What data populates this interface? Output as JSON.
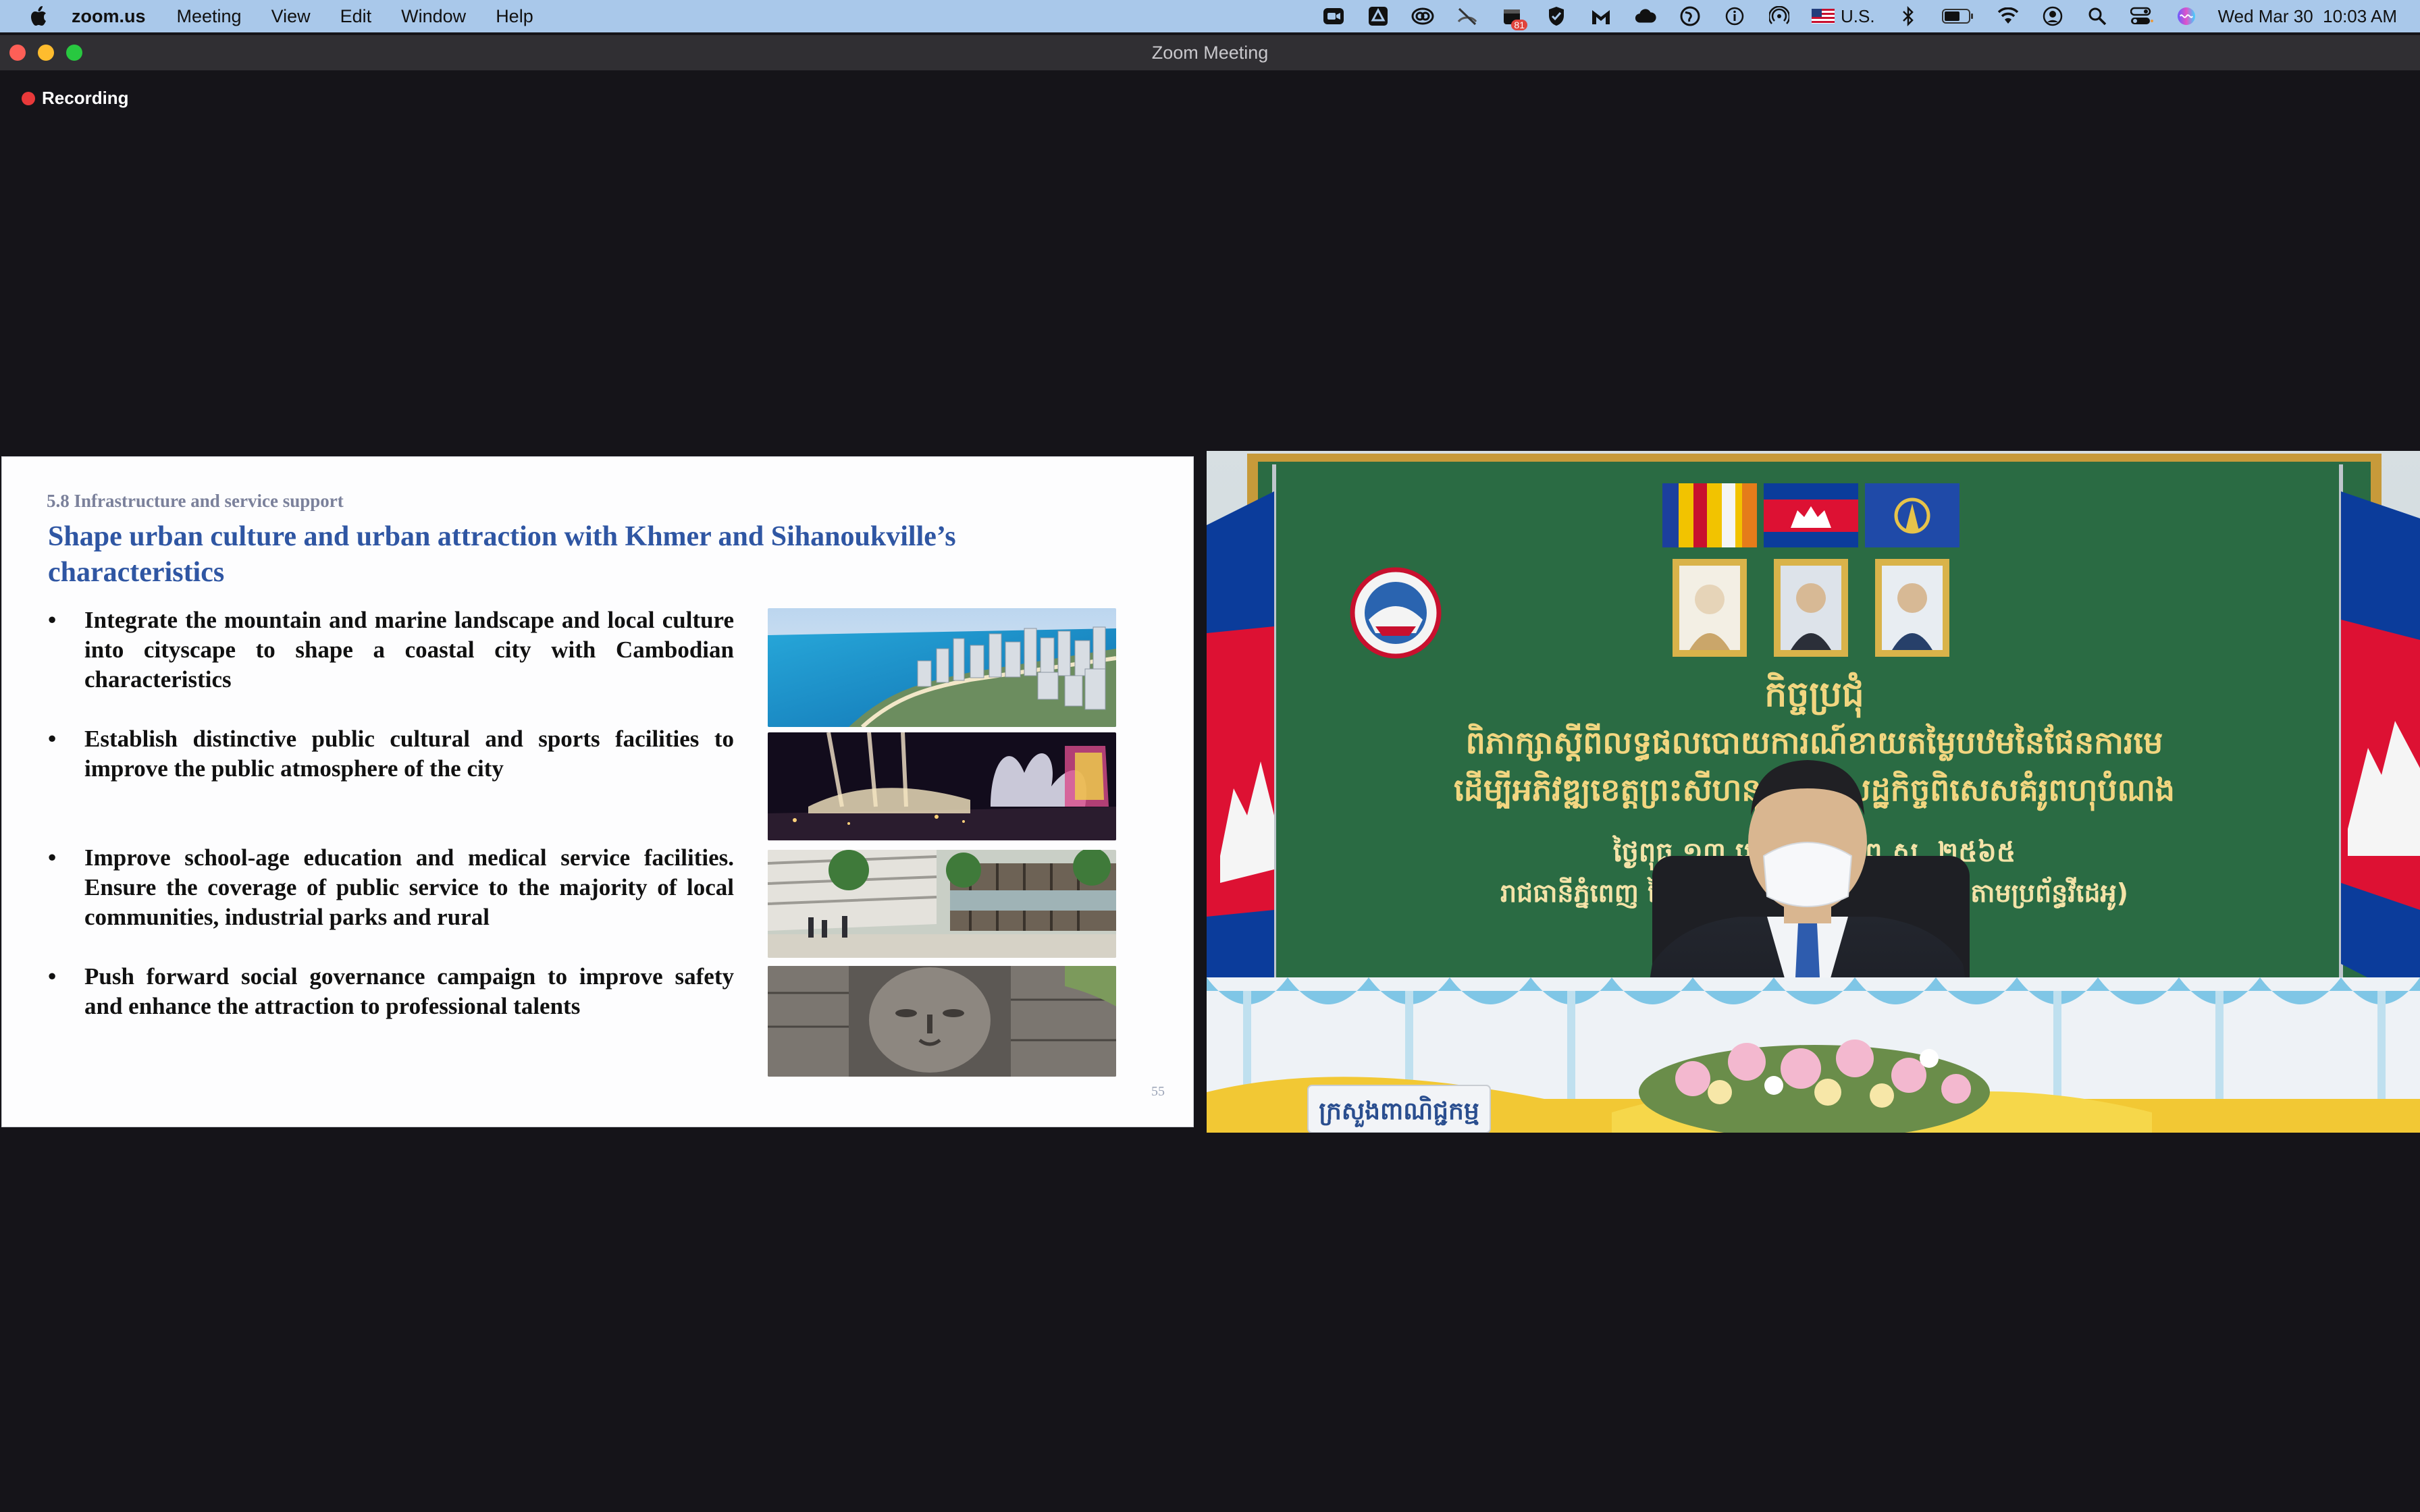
{
  "menubar": {
    "app_name": "zoom.us",
    "items": [
      "Meeting",
      "View",
      "Edit",
      "Window",
      "Help"
    ],
    "tray": {
      "notification_badge": "81",
      "input_source": "U.S.",
      "datetime": "Wed Mar 30  10:03 AM"
    }
  },
  "window": {
    "title": "Zoom Meeting"
  },
  "recording": {
    "label": "Recording"
  },
  "slide": {
    "subtitle": "5.8 Infrastructure and service support",
    "title": "Shape urban culture and urban attraction with Khmer and Sihanoukville’s characteristics",
    "bullets": [
      "Integrate the mountain and marine landscape and local culture into cityscape to shape a coastal city with Cambodian characteristics",
      "Establish distinctive public cultural and sports facilities to improve the public atmosphere of the city",
      "Improve school-age education and medical service facilities. Ensure the coverage of public service to the majority of local communities, industrial parks and rural",
      "Push forward social governance campaign to improve safety and enhance the attraction to professional talents"
    ],
    "page_number": "55"
  },
  "video": {
    "banner_line1": "កិច្ចប្រជុំ",
    "banner_line2": "ពិភាក្សាស្តីពីលទ្ធផលបោយការណ៍ខាយតម្លៃបឋមនៃផែនការមេ",
    "banner_line3": "ដើម្បីអភិវឌ្ឍខេត្តព្រះសីហនុ តំបន់សេដ្ឋកិច្ចពិសេសគំរូពហុបំណង",
    "banner_line4": "ថ្ងៃពុធ ១៣ រោច ត្រីស័ក ព.ស. ២៥៦៥",
    "banner_line5": "រាជធានីភ្នំពេញ ថ្ងៃទី៣០ ម៉ោង ៩:០០ នាទីព្រឹក (តាមប្រព័ន្ធវីដេអូ)",
    "desk_sign": "ក្រសួងពាណិជ្ជកម្ម"
  }
}
